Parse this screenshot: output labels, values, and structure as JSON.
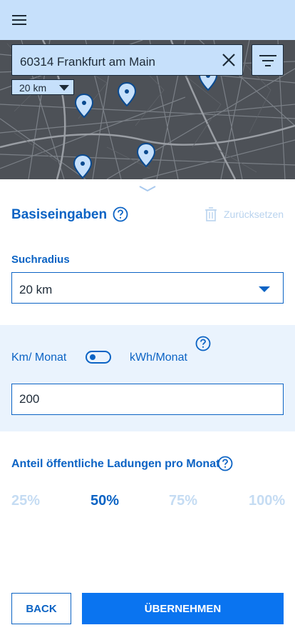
{
  "header": {
    "menu_icon": "hamburger-icon"
  },
  "map": {
    "search": {
      "value": "60314 Frankfurt am Main",
      "clear_icon": "close-icon"
    },
    "filter_icon": "filter-icon",
    "radius_chip": {
      "value": "20 km"
    },
    "pin_icon": "map-pin-icon"
  },
  "sheet": {
    "handle_icon": "chevron-down-icon",
    "title": "Basiseingaben",
    "reset_label": "Zurücksetzen",
    "radius": {
      "label": "Suchradius",
      "value": "20 km"
    },
    "unit_toggle": {
      "left_label": "Km/ Monat",
      "right_label": "kWh/Monat",
      "input_value": "200"
    },
    "public_share": {
      "label": "Anteil öffentliche Ladungen pro Monat",
      "options": [
        "25%",
        "50%",
        "75%",
        "100%"
      ],
      "selected": "50%"
    }
  },
  "actions": {
    "back_label": "BACK",
    "apply_label": "ÜBERNEHMEN"
  },
  "colors": {
    "accent": "#0B63C4",
    "primary_button": "#0A74F0",
    "header_bg": "#C6E0FB",
    "band_bg": "#EAF3FD"
  }
}
